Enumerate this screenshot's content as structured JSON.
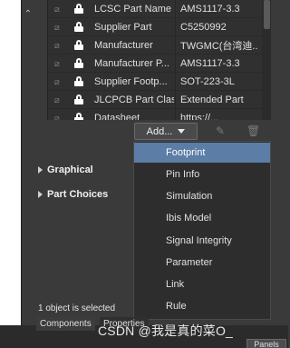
{
  "parameters": {
    "rows": [
      {
        "name": "LCSC Part Name",
        "value": "AMS1117-3.3"
      },
      {
        "name": "Supplier Part",
        "value": "C5250992"
      },
      {
        "name": "Manufacturer",
        "value": "TWGMC(台湾迪..."
      },
      {
        "name": "Manufacturer P...",
        "value": "AMS1117-3.3"
      },
      {
        "name": "Supplier Footp...",
        "value": "SOT-223-3L"
      },
      {
        "name": "JLCPCB Part Class",
        "value": "Extended Part"
      },
      {
        "name": "Datasheet",
        "value": "https://..."
      }
    ]
  },
  "toolbar": {
    "add_label": "Add..."
  },
  "sections": {
    "graphical": "Graphical",
    "part_choices": "Part Choices"
  },
  "add_menu": {
    "items": [
      "Footprint",
      "Pin Info",
      "Simulation",
      "Ibis Model",
      "Signal Integrity",
      "Parameter",
      "Link",
      "Rule"
    ],
    "selected_index": 0
  },
  "status": {
    "selection": "1 object is selected"
  },
  "tabs": {
    "components": "Components",
    "properties": "Properties"
  },
  "panels_button": "Panels",
  "watermark": "CSDN @我是真的菜O_",
  "colors": {
    "selected_item": "#5b7da6",
    "panel_bg": "#3a3a3b"
  }
}
